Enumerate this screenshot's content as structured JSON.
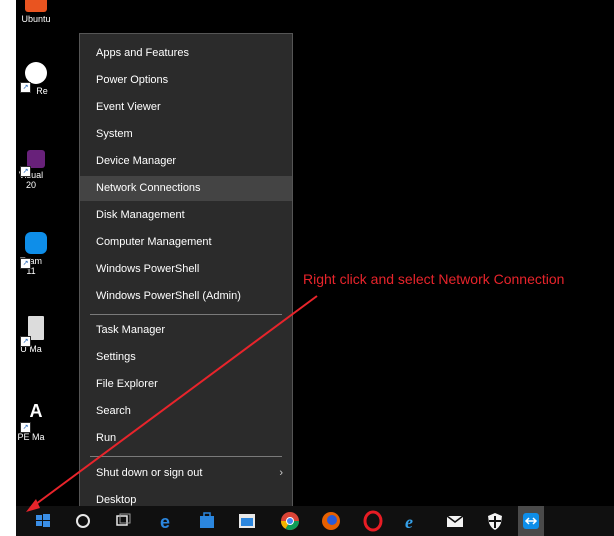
{
  "desktop": {
    "icons": [
      {
        "label": "Ubuntu"
      },
      {
        "label": "Re"
      },
      {
        "label": "Visual 20"
      },
      {
        "label": "Team 11"
      },
      {
        "label": "U Ma"
      },
      {
        "label": "PE Ma"
      }
    ]
  },
  "menu": {
    "items_group1": [
      "Apps and Features",
      "Power Options",
      "Event Viewer",
      "System",
      "Device Manager",
      "Network Connections",
      "Disk Management",
      "Computer Management",
      "Windows PowerShell",
      "Windows PowerShell (Admin)"
    ],
    "items_group2": [
      "Task Manager",
      "Settings",
      "File Explorer",
      "Search",
      "Run"
    ],
    "items_group3": [
      "Shut down or sign out",
      "Desktop"
    ],
    "highlighted": "Network Connections",
    "chevron": "›"
  },
  "annotation": {
    "text": "Right click and select Network Connection",
    "color": "#e8242b"
  },
  "taskbar": {
    "icons": [
      "start-icon",
      "cortana-icon",
      "task-view-icon",
      "edge-icon",
      "store-icon",
      "app-icon",
      "chrome-icon",
      "firefox-icon",
      "opera-icon",
      "ie-icon",
      "mail-icon",
      "security-icon",
      "teamviewer-icon"
    ]
  }
}
